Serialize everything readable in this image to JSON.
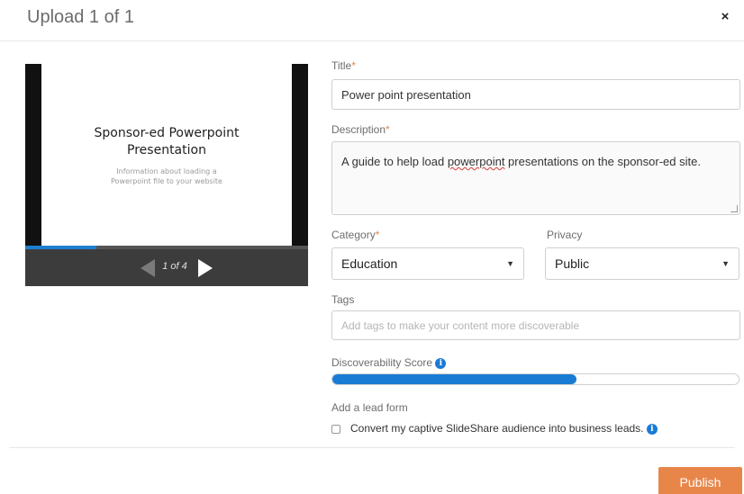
{
  "dialog": {
    "title": "Upload 1 of 1",
    "close_symbol": "×"
  },
  "preview": {
    "slide_title_line1": "Sponsor-ed Powerpoint",
    "slide_title_line2": "Presentation",
    "slide_sub_line1": "Information about loading a",
    "slide_sub_line2": "Powerpoint file to your website",
    "page_indicator": "1 of 4",
    "progress_fraction": 0.25
  },
  "form": {
    "title_label": "Title",
    "title_value": "Power point presentation",
    "description_label": "Description",
    "description_before": "A guide to help load ",
    "description_misspelled": "powerpoint",
    "description_after": " presentations on the sponsor-ed site.",
    "category_label": "Category",
    "category_value": "Education",
    "privacy_label": "Privacy",
    "privacy_value": "Public",
    "tags_label": "Tags",
    "tags_placeholder": "Add tags to make your content more discoverable",
    "score_label": "Discoverability Score",
    "score_fraction": 0.6,
    "lead_label": "Add a lead form",
    "lead_checkbox_label": "Convert my captive SlideShare audience into business leads.",
    "required_mark": "*",
    "select_caret": "▼",
    "info_symbol": "i"
  },
  "footer": {
    "publish_label": "Publish"
  },
  "colors": {
    "accent_orange": "#e8864a",
    "accent_blue": "#1a7bd4"
  },
  "icons": [
    "close-icon",
    "prev-slide-icon",
    "next-slide-icon",
    "info-icon",
    "chevron-down-icon"
  ]
}
